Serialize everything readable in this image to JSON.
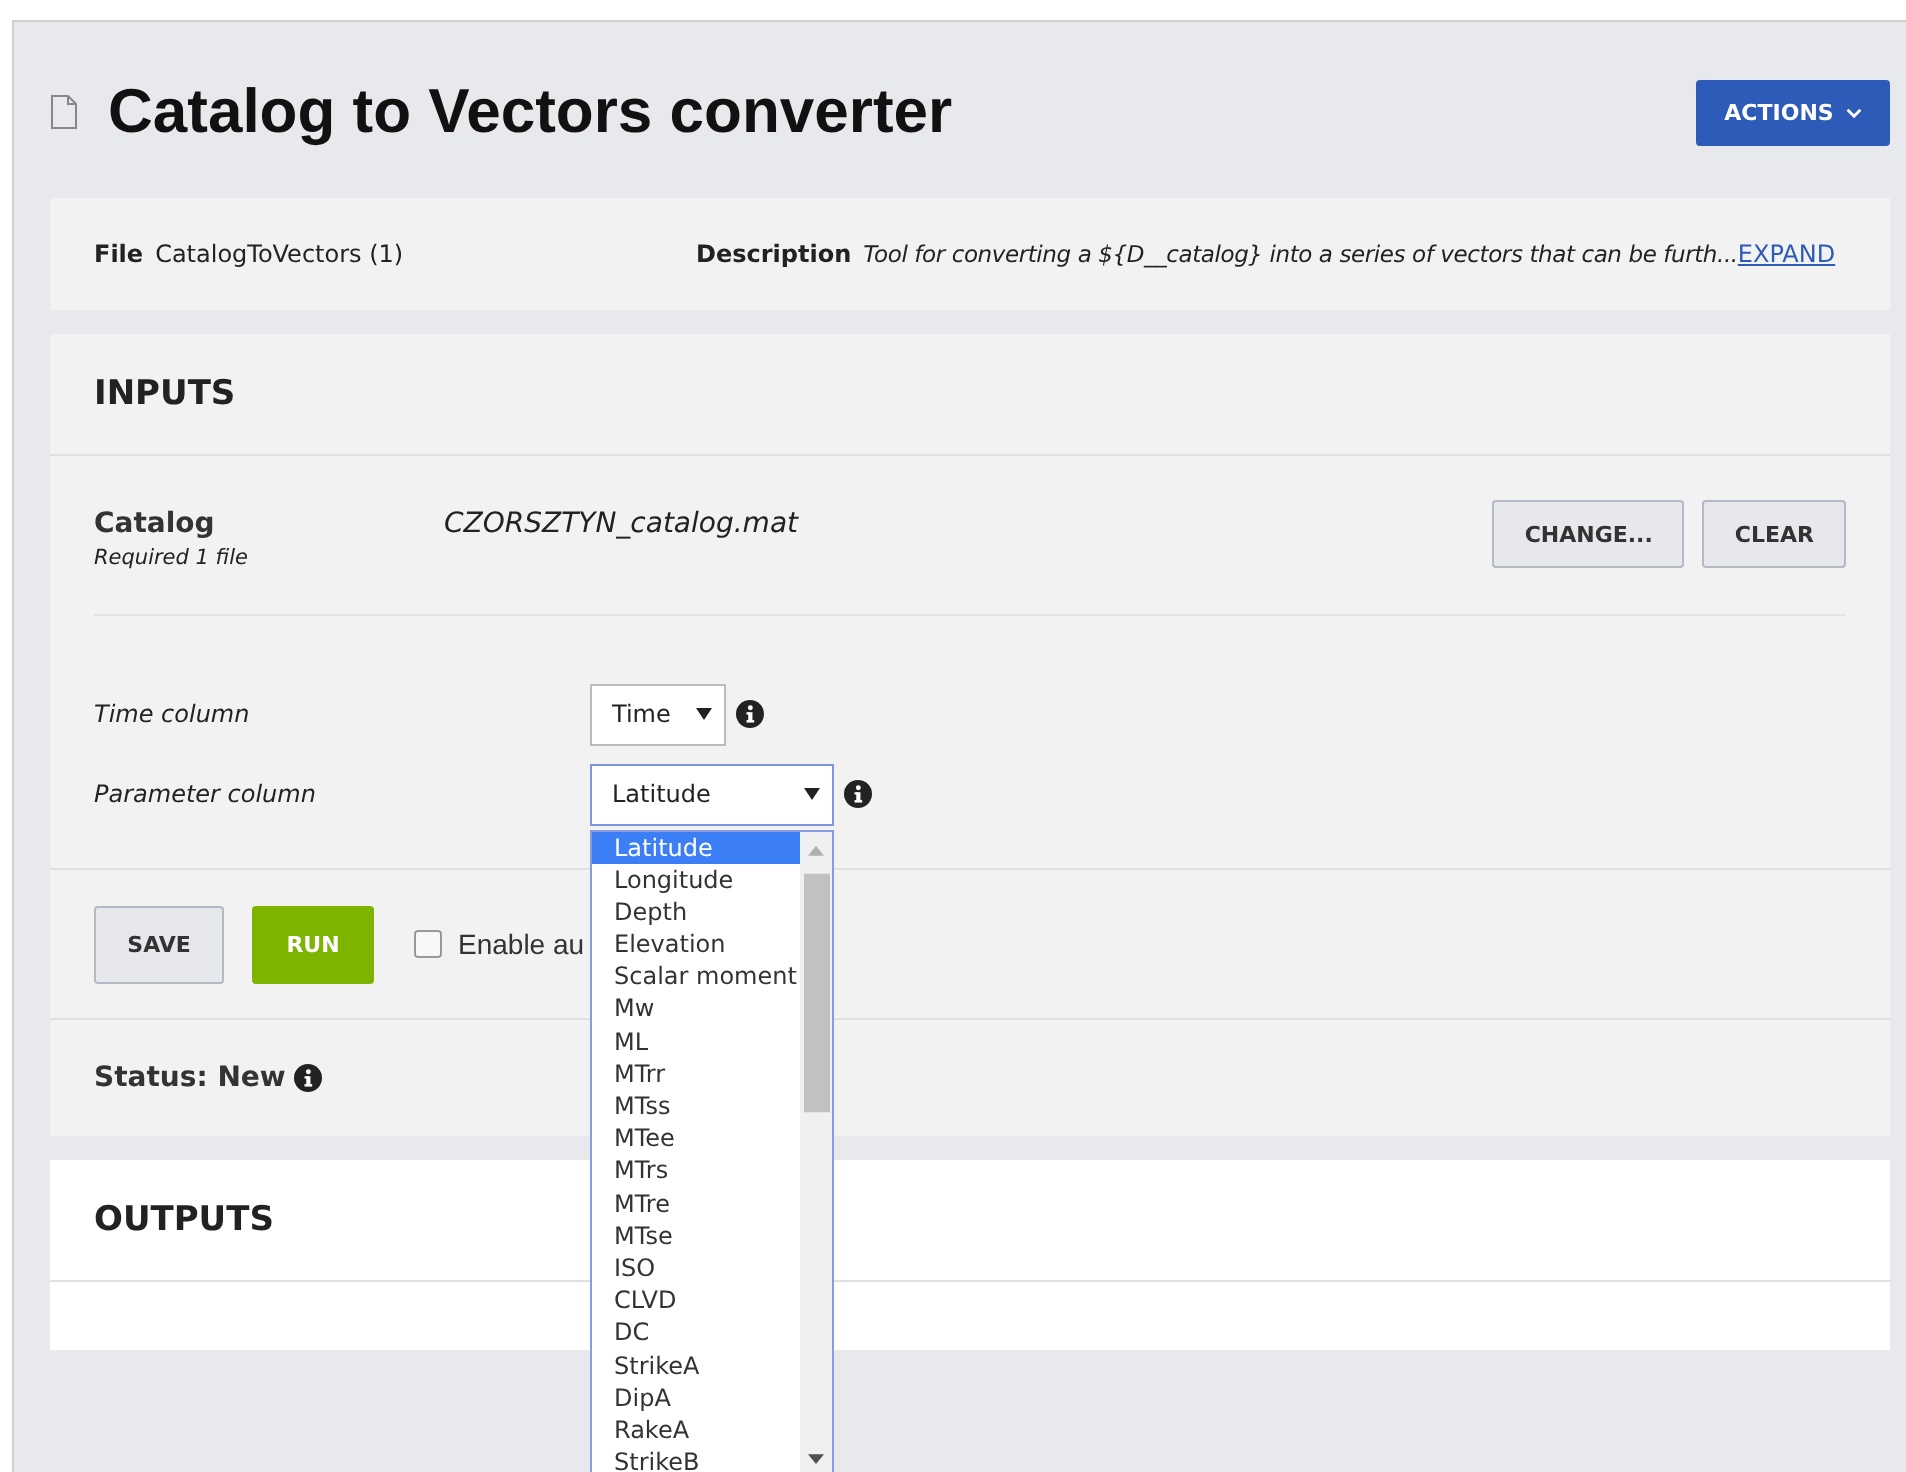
{
  "page": {
    "title": "Catalog to Vectors converter",
    "actions_button": "ACTIONS"
  },
  "info": {
    "file_label": "File",
    "file_value": "CatalogToVectors (1)",
    "description_label": "Description",
    "description_value": "Tool for converting a ${D__catalog} into a series of vectors that can be furth...",
    "expand_link": "EXPAND"
  },
  "inputs": {
    "heading": "INPUTS",
    "catalog": {
      "label": "Catalog",
      "requirement": "Required 1 file",
      "file_name": "CZORSZTYN_catalog.mat",
      "buttons": [
        "CHANGE...",
        "CLEAR"
      ]
    },
    "parameters": [
      {
        "label": "Time column",
        "value": "Time",
        "open": false
      },
      {
        "label": "Parameter column",
        "value": "Latitude",
        "open": true
      }
    ],
    "options": [
      {
        "label": "Latitude",
        "selected": true
      },
      {
        "label": "Longitude",
        "selected": false
      },
      {
        "label": "Depth",
        "selected": false
      },
      {
        "label": "Elevation",
        "selected": false
      },
      {
        "label": "Scalar moment",
        "selected": false
      },
      {
        "label": "Mw",
        "selected": false
      },
      {
        "label": "ML",
        "selected": false
      },
      {
        "label": "MTrr",
        "selected": false
      },
      {
        "label": "MTss",
        "selected": false
      },
      {
        "label": "MTee",
        "selected": false
      },
      {
        "label": "MTrs",
        "selected": false
      },
      {
        "label": "MTre",
        "selected": false
      },
      {
        "label": "MTse",
        "selected": false
      },
      {
        "label": "ISO",
        "selected": false
      },
      {
        "label": "CLVD",
        "selected": false
      },
      {
        "label": "DC",
        "selected": false
      },
      {
        "label": "StrikeA",
        "selected": false
      },
      {
        "label": "DipA",
        "selected": false
      },
      {
        "label": "RakeA",
        "selected": false
      },
      {
        "label": "StrikeB",
        "selected": false
      }
    ],
    "save_button": "SAVE",
    "run_button": "RUN",
    "auto_checkbox": {
      "label": "Enable au",
      "checked": false
    },
    "status": "Status: New"
  },
  "outputs": {
    "heading": "OUTPUTS"
  }
}
